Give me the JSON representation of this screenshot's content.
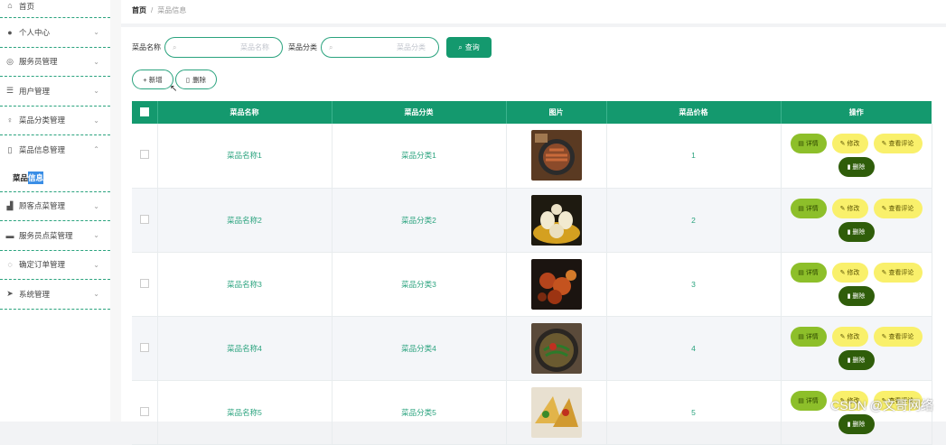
{
  "sidebar": {
    "items": [
      {
        "label": "首页",
        "icon": "home-icon",
        "glyph": "⌂"
      },
      {
        "label": "个人中心",
        "icon": "user-icon",
        "glyph": "●"
      },
      {
        "label": "服务员管理",
        "icon": "circle-icon",
        "glyph": "◎"
      },
      {
        "label": "用户管理",
        "icon": "list-icon",
        "glyph": "☰"
      },
      {
        "label": "菜品分类管理",
        "icon": "microphone-icon",
        "glyph": "♀"
      },
      {
        "label": "菜品信息管理",
        "icon": "phone-icon",
        "glyph": "▯"
      },
      {
        "label": "顾客点菜管理",
        "icon": "chart-icon",
        "glyph": "▟"
      },
      {
        "label": "服务员点菜管理",
        "icon": "briefcase-icon",
        "glyph": "▬"
      },
      {
        "label": "确定订单管理",
        "icon": "clock-icon",
        "glyph": "◌"
      },
      {
        "label": "系统管理",
        "icon": "send-icon",
        "glyph": "➤"
      }
    ],
    "sub_item": {
      "label_plain": "菜品",
      "label_highlight": "信息"
    }
  },
  "breadcrumb": {
    "home": "首页",
    "separator": "/",
    "current": "菜品信息"
  },
  "search": {
    "name_label": "菜品名称",
    "name_placeholder": "菜品名称",
    "category_label": "菜品分类",
    "category_placeholder": "菜品分类",
    "query_button": "查询"
  },
  "actions": {
    "add_button": "+ 新增",
    "delete_button": "删除"
  },
  "table": {
    "headers": [
      "菜品名称",
      "菜品分类",
      "图片",
      "菜品价格",
      "操作"
    ],
    "rows": [
      {
        "name": "菜品名称1",
        "category": "菜品分类1",
        "price": "1"
      },
      {
        "name": "菜品名称2",
        "category": "菜品分类2",
        "price": "2"
      },
      {
        "name": "菜品名称3",
        "category": "菜品分类3",
        "price": "3"
      },
      {
        "name": "菜品名称4",
        "category": "菜品分类4",
        "price": "4"
      },
      {
        "name": "菜品名称5",
        "category": "菜品分类5",
        "price": "5"
      }
    ],
    "op_labels": {
      "detail": "详情",
      "edit": "修改",
      "review": "查看评论",
      "delete": "删除"
    }
  },
  "watermark": "CSDN @文哥网络",
  "colors": {
    "accent": "#14996e",
    "dashed": "#2aa37e",
    "detail": "#8dbf2a",
    "edit": "#f9f06b",
    "delete": "#2f5d0a"
  }
}
